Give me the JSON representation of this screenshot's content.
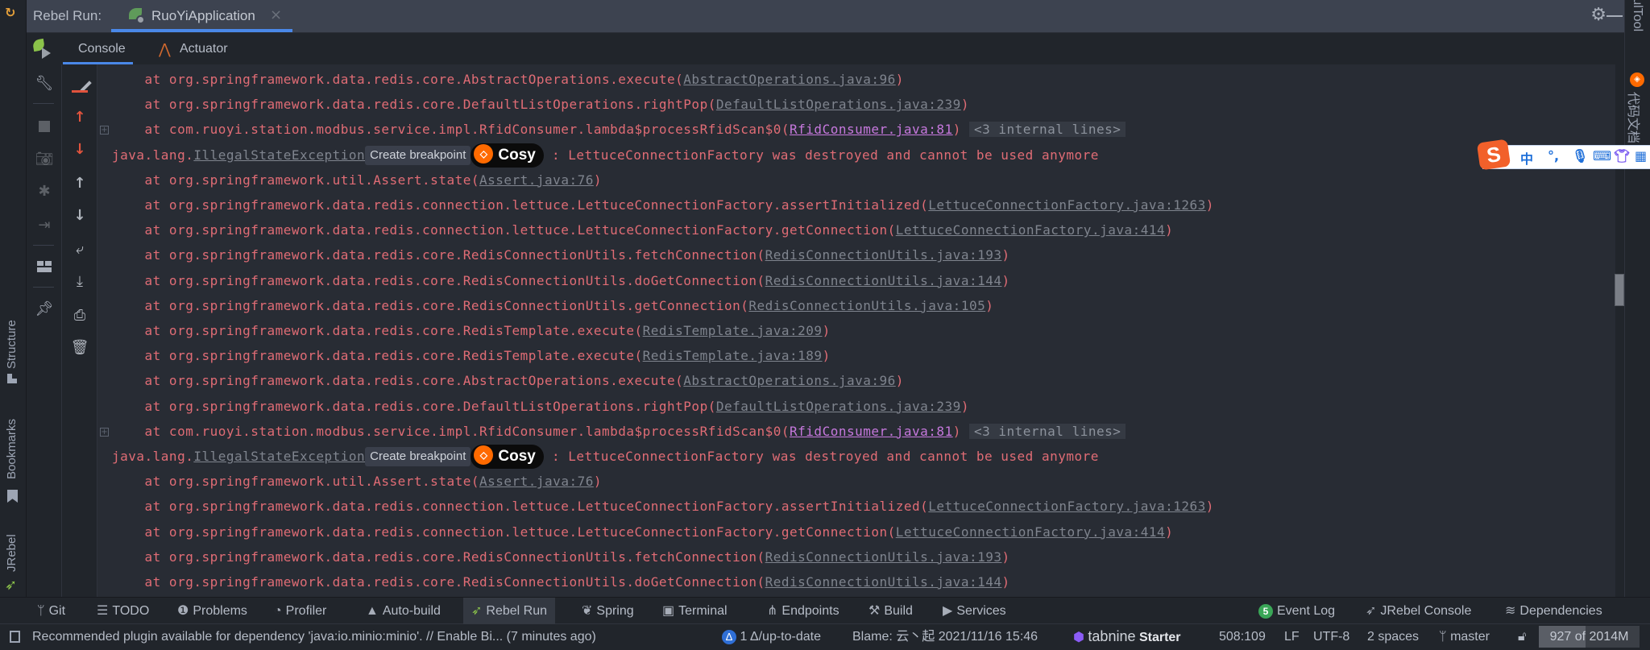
{
  "run_panel": {
    "label": "Rebel Run:",
    "tab_name": "RuoYiApplication",
    "close_glyph": "×",
    "subtabs": [
      "Console",
      "Actuator"
    ]
  },
  "left_strip": {
    "labels": [
      "Structure",
      "Bookmarks",
      "JRebel"
    ]
  },
  "right_strip": {
    "labels": [
      "RestfulTool",
      "代码文档"
    ]
  },
  "toolbar_col1": [
    "jrebel-run-icon",
    "wrench-icon",
    "stop-icon",
    "camera-icon",
    "debug-icon",
    "login-icon",
    "layout-icon",
    "pin-icon"
  ],
  "toolbar_col2": [
    "clear-icon",
    "up-red-icon",
    "down-red-icon",
    "up-icon",
    "down-icon",
    "soft-wrap-icon",
    "scroll-end-icon",
    "print-icon",
    "trash-icon"
  ],
  "console": {
    "lines": [
      {
        "type": "at",
        "prefix": "    at org.springframework.data.redis.core.AbstractOperations.execute(",
        "link": "AbstractOperations.java:96",
        "suffix": ")"
      },
      {
        "type": "at",
        "prefix": "    at org.springframework.data.redis.core.DefaultListOperations.rightPop(",
        "link": "DefaultListOperations.java:239",
        "suffix": ")"
      },
      {
        "type": "fold",
        "prefix": "    at com.ruoyi.station.modbus.service.impl.RfidConsumer.lambda$processRfidScan$0(",
        "link": "RfidConsumer.java:81",
        "suffix": ")",
        "internal": "<3 internal lines>"
      },
      {
        "type": "exception",
        "prefix": "java.lang.",
        "exception": "IllegalStateException",
        "breakpoint": "Create breakpoint",
        "cosy": "Cosy",
        "message": " : LettuceConnectionFactory was destroyed and cannot be used anymore"
      },
      {
        "type": "at",
        "prefix": "    at org.springframework.util.Assert.state(",
        "link": "Assert.java:76",
        "suffix": ")"
      },
      {
        "type": "at",
        "prefix": "    at org.springframework.data.redis.connection.lettuce.LettuceConnectionFactory.assertInitialized(",
        "link": "LettuceConnectionFactory.java:1263",
        "suffix": ")"
      },
      {
        "type": "at",
        "prefix": "    at org.springframework.data.redis.connection.lettuce.LettuceConnectionFactory.getConnection(",
        "link": "LettuceConnectionFactory.java:414",
        "suffix": ")"
      },
      {
        "type": "at",
        "prefix": "    at org.springframework.data.redis.core.RedisConnectionUtils.fetchConnection(",
        "link": "RedisConnectionUtils.java:193",
        "suffix": ")"
      },
      {
        "type": "at",
        "prefix": "    at org.springframework.data.redis.core.RedisConnectionUtils.doGetConnection(",
        "link": "RedisConnectionUtils.java:144",
        "suffix": ")"
      },
      {
        "type": "at",
        "prefix": "    at org.springframework.data.redis.core.RedisConnectionUtils.getConnection(",
        "link": "RedisConnectionUtils.java:105",
        "suffix": ")"
      },
      {
        "type": "at",
        "prefix": "    at org.springframework.data.redis.core.RedisTemplate.execute(",
        "link": "RedisTemplate.java:209",
        "suffix": ")"
      },
      {
        "type": "at",
        "prefix": "    at org.springframework.data.redis.core.RedisTemplate.execute(",
        "link": "RedisTemplate.java:189",
        "suffix": ")"
      },
      {
        "type": "at",
        "prefix": "    at org.springframework.data.redis.core.AbstractOperations.execute(",
        "link": "AbstractOperations.java:96",
        "suffix": ")"
      },
      {
        "type": "at",
        "prefix": "    at org.springframework.data.redis.core.DefaultListOperations.rightPop(",
        "link": "DefaultListOperations.java:239",
        "suffix": ")"
      },
      {
        "type": "fold",
        "prefix": "    at com.ruoyi.station.modbus.service.impl.RfidConsumer.lambda$processRfidScan$0(",
        "link": "RfidConsumer.java:81",
        "suffix": ")",
        "internal": "<3 internal lines>"
      },
      {
        "type": "exception",
        "prefix": "java.lang.",
        "exception": "IllegalStateException",
        "breakpoint": "Create breakpoint",
        "cosy": "Cosy",
        "message": " : LettuceConnectionFactory was destroyed and cannot be used anymore"
      },
      {
        "type": "at",
        "prefix": "    at org.springframework.util.Assert.state(",
        "link": "Assert.java:76",
        "suffix": ")"
      },
      {
        "type": "at",
        "prefix": "    at org.springframework.data.redis.connection.lettuce.LettuceConnectionFactory.assertInitialized(",
        "link": "LettuceConnectionFactory.java:1263",
        "suffix": ")"
      },
      {
        "type": "at",
        "prefix": "    at org.springframework.data.redis.connection.lettuce.LettuceConnectionFactory.getConnection(",
        "link": "LettuceConnectionFactory.java:414",
        "suffix": ")"
      },
      {
        "type": "at",
        "prefix": "    at org.springframework.data.redis.core.RedisConnectionUtils.fetchConnection(",
        "link": "RedisConnectionUtils.java:193",
        "suffix": ")"
      },
      {
        "type": "at",
        "prefix": "    at org.springframework.data.redis.core.RedisConnectionUtils.doGetConnection(",
        "link": "RedisConnectionUtils.java:144",
        "suffix": ")"
      }
    ]
  },
  "ime_toolbar": {
    "logo": "S",
    "items": [
      "中",
      "°,",
      "mic",
      "keyboard",
      "skin",
      "apps"
    ]
  },
  "bottom_tools": {
    "left": [
      {
        "label": "Git",
        "icon": "git-branch-icon"
      },
      {
        "label": "TODO",
        "icon": "list-icon"
      },
      {
        "label": "Problems",
        "icon": "problems-icon"
      },
      {
        "label": "Profiler",
        "icon": "profiler-icon"
      },
      {
        "label": "Auto-build",
        "icon": "warning-icon"
      },
      {
        "label": "Rebel Run",
        "icon": "jrebel-icon",
        "active": true
      },
      {
        "label": "Spring",
        "icon": "spring-icon"
      },
      {
        "label": "Terminal",
        "icon": "terminal-icon"
      },
      {
        "label": "Endpoints",
        "icon": "endpoints-icon"
      },
      {
        "label": "Build",
        "icon": "hammer-icon"
      },
      {
        "label": "Services",
        "icon": "services-icon"
      }
    ],
    "right": [
      {
        "label": "Event Log",
        "icon": "event-log-icon",
        "badge": "5"
      },
      {
        "label": "JRebel Console",
        "icon": "jrebel-console-icon"
      },
      {
        "label": "Dependencies",
        "icon": "layers-icon"
      }
    ]
  },
  "status_bar": {
    "message": "Recommended plugin available for dependency 'java:io.minio:minio'. // Enable Bi... (7 minutes ago)",
    "vcs_status": "1 Δ/up-to-date",
    "blame": "Blame: 云丶起 2021/11/16 15:46",
    "tabnine_brand": "tabnine",
    "tabnine_plan": "Starter",
    "position": "508:109",
    "line_ending": "LF",
    "encoding": "UTF-8",
    "indent": "2 spaces",
    "branch": "master",
    "memory": {
      "used_mb": 927,
      "total_mb": 2014,
      "text": "927 of 2014M",
      "fraction": 0.46
    }
  },
  "colors": {
    "accent": "#4a88e8",
    "error_text": "#e06c75",
    "link_text": "#7f848e",
    "project_link": "#c678dd",
    "console_bg": "#282c34"
  }
}
